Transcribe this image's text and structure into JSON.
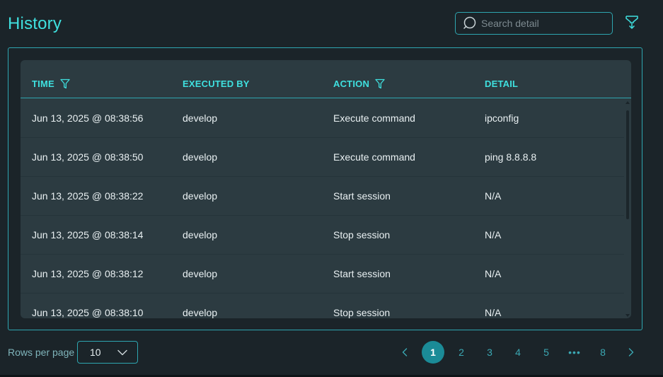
{
  "header": {
    "title": "History",
    "search_placeholder": "Search detail"
  },
  "table": {
    "columns": [
      {
        "label": "TIME",
        "filter": true
      },
      {
        "label": "EXECUTED BY",
        "filter": false
      },
      {
        "label": "ACTION",
        "filter": true
      },
      {
        "label": "DETAIL",
        "filter": false
      }
    ],
    "rows": [
      {
        "time": "Jun 13, 2025 @ 08:38:56",
        "executed_by": "develop",
        "action": "Execute command",
        "detail": "ipconfig"
      },
      {
        "time": "Jun 13, 2025 @ 08:38:50",
        "executed_by": "develop",
        "action": "Execute command",
        "detail": "ping 8.8.8.8"
      },
      {
        "time": "Jun 13, 2025 @ 08:38:22",
        "executed_by": "develop",
        "action": "Start session",
        "detail": "N/A"
      },
      {
        "time": "Jun 13, 2025 @ 08:38:14",
        "executed_by": "develop",
        "action": "Stop session",
        "detail": "N/A"
      },
      {
        "time": "Jun 13, 2025 @ 08:38:12",
        "executed_by": "develop",
        "action": "Start session",
        "detail": "N/A"
      },
      {
        "time": "Jun 13, 2025 @ 08:38:10",
        "executed_by": "develop",
        "action": "Stop session",
        "detail": "N/A"
      }
    ]
  },
  "footer": {
    "rows_per_page_label": "Rows per page",
    "rows_per_page_value": "10",
    "pages": [
      "1",
      "2",
      "3",
      "4",
      "5",
      "•••",
      "8"
    ],
    "current_page": "1"
  },
  "icons": {
    "search": "search-icon",
    "filter": "filter-icon",
    "funnel": "funnel-icon",
    "chevron_down": "chevron-down-icon",
    "chevron_left": "chevron-left-icon",
    "chevron_right": "chevron-right-icon"
  },
  "colors": {
    "accent": "#3fe0df",
    "border": "#2ea6b0",
    "background": "#1b2429",
    "table_background": "#2c3b41",
    "active_page": "#1b8b97"
  }
}
